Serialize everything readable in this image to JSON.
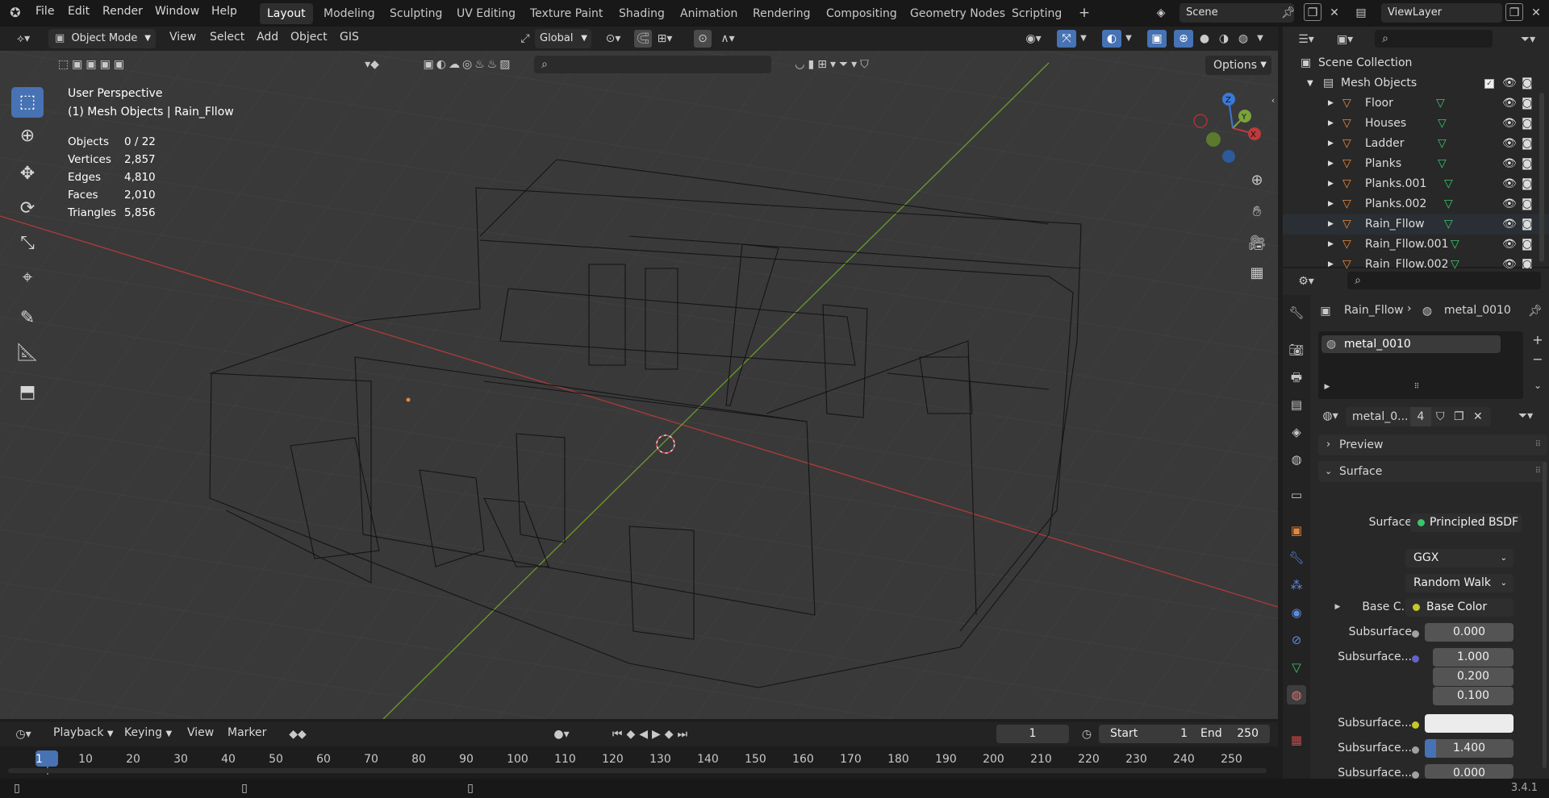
{
  "topbar": {
    "menus": [
      "File",
      "Edit",
      "Render",
      "Window",
      "Help"
    ],
    "workspaces": [
      "Layout",
      "Modeling",
      "Sculpting",
      "UV Editing",
      "Texture Paint",
      "Shading",
      "Animation",
      "Rendering",
      "Compositing",
      "Geometry Nodes",
      "Scripting"
    ],
    "active_workspace": "Layout",
    "scene": "Scene",
    "view_layer": "ViewLayer"
  },
  "viewport_header": {
    "mode": "Object Mode",
    "menus": [
      "View",
      "Select",
      "Add",
      "Object",
      "GIS"
    ],
    "orientation": "Global",
    "options": "Options"
  },
  "overlay": {
    "view_name": "User Perspective",
    "collection": "(1) Mesh Objects | Rain_Fllow",
    "stats": [
      {
        "label": "Objects",
        "value": "0 / 22"
      },
      {
        "label": "Vertices",
        "value": "2,857"
      },
      {
        "label": "Edges",
        "value": "4,810"
      },
      {
        "label": "Faces",
        "value": "2,010"
      },
      {
        "label": "Triangles",
        "value": "5,856"
      }
    ]
  },
  "gizmo": {
    "x": "X",
    "y": "Y",
    "z": "Z"
  },
  "outliner": {
    "root": "Scene Collection",
    "collection": "Mesh Objects",
    "items": [
      "Floor",
      "Houses",
      "Ladder",
      "Planks",
      "Planks.001",
      "Planks.002",
      "Rain_Fllow",
      "Rain_Fllow.001",
      "Rain_Fllow.002"
    ],
    "selected": "Rain_Fllow"
  },
  "properties": {
    "breadcrumb_object": "Rain_Fllow",
    "breadcrumb_material": "metal_0010",
    "slot": "metal_0010",
    "material_name": "metal_0...",
    "users": "4",
    "panel_preview": "Preview",
    "panel_surface": "Surface",
    "surface_label": "Surface",
    "surface_value": "Principled BSDF",
    "distribution": "GGX",
    "subsurface_method": "Random Walk",
    "rows": {
      "base_color_label": "Base C...",
      "base_color_value": "Base Color",
      "subsurface_label": "Subsurface",
      "subsurface_value": "0.000",
      "subsurface_radius_label": "Subsurface...",
      "radius": [
        "1.000",
        "0.200",
        "0.100"
      ],
      "subsurface_color_label": "Subsurface...",
      "subsurface_ior_label": "Subsurface...",
      "subsurface_ior_value": "1.400",
      "subsurface_aniso_label": "Subsurface...",
      "subsurface_aniso_value": "0.000"
    }
  },
  "timeline": {
    "menus": [
      "Playback",
      "Keying",
      "View",
      "Marker"
    ],
    "current_frame": "1",
    "start_label": "Start",
    "start": "1",
    "end_label": "End",
    "end": "250",
    "ruler": [
      "1",
      "10",
      "20",
      "30",
      "40",
      "50",
      "60",
      "70",
      "80",
      "90",
      "100",
      "110",
      "120",
      "130",
      "140",
      "150",
      "160",
      "170",
      "180",
      "190",
      "200",
      "210",
      "220",
      "230",
      "240",
      "250"
    ]
  },
  "status": {
    "version": "3.4.1"
  },
  "colors": {
    "accent": "#4772b3",
    "x_axis": "#c0393b",
    "y_axis": "#7ba33a",
    "z_axis": "#3b78d8",
    "orange": "#e8863a"
  }
}
